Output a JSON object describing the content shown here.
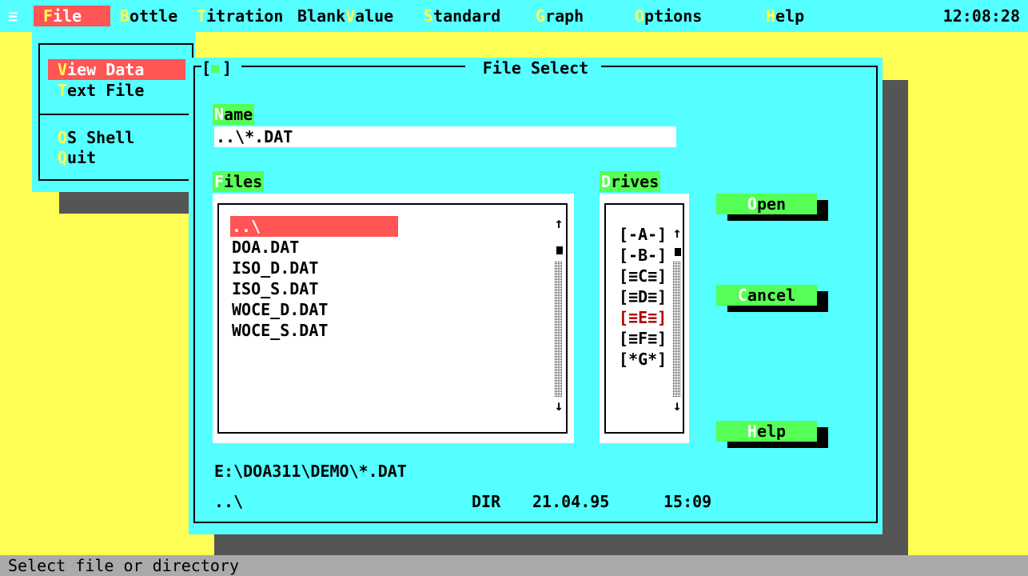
{
  "menubar": {
    "system_glyph": "≡",
    "items": [
      {
        "hotkey": "F",
        "rest": "ile"
      },
      {
        "hotkey": "B",
        "rest": "ottle"
      },
      {
        "hotkey": "T",
        "rest": "itration"
      },
      {
        "hotkey": "",
        "rest": "Blank"
      },
      {
        "hotkey": "V",
        "rest": "alue"
      },
      {
        "hotkey": "S",
        "rest": "tandard"
      },
      {
        "hotkey": "G",
        "rest": "raph"
      },
      {
        "hotkey": "O",
        "rest": "ptions"
      },
      {
        "hotkey": "H",
        "rest": "elp"
      }
    ],
    "clock": "12:08:28"
  },
  "file_menu": {
    "items": [
      {
        "hotkey": "V",
        "rest": "iew Data",
        "selected": true
      },
      {
        "hotkey": "T",
        "rest": "ext File",
        "selected": false
      },
      {
        "hotkey": "O",
        "rest": "S Shell",
        "selected": false
      },
      {
        "hotkey": "Q",
        "rest": "uit",
        "selected": false
      }
    ]
  },
  "dialog": {
    "title": "File Select",
    "close_left": "[",
    "close_right": "]",
    "name_label": {
      "hotkey": "N",
      "rest": "ame"
    },
    "name_value": "..\\*.DAT",
    "files_label": {
      "hotkey": "F",
      "rest": "iles"
    },
    "files": [
      "..\\",
      "DOA.DAT",
      "ISO_D.DAT",
      "ISO_S.DAT",
      "WOCE_D.DAT",
      "WOCE_S.DAT"
    ],
    "selected_file_index": 0,
    "drives_label": {
      "hotkey": "D",
      "rest": "rives"
    },
    "drives": [
      "[-A-]",
      "[-B-]",
      "[≡C≡]",
      "[≡D≡]",
      "[≡E≡]",
      "[≡F≡]",
      "[*G*]"
    ],
    "current_drive_index": 4,
    "buttons": {
      "open": {
        "hotkey": "O",
        "rest": "pen"
      },
      "cancel": {
        "hotkey": "C",
        "rest": "ancel"
      },
      "help": {
        "hotkey": "H",
        "rest": "elp"
      }
    },
    "path": "E:\\DOA311\\DEMO\\*.DAT",
    "info": {
      "name": "..\\",
      "type": "DIR",
      "date": "21.04.95",
      "time": "15:09"
    }
  },
  "scroll_arrows": {
    "up": "↑",
    "down": "↓"
  },
  "colors": {
    "desktop": "#ffff55",
    "cyan": "#55ffff",
    "green": "#55ff55",
    "selection": "#ff5555",
    "shadow": "#555555",
    "status_bar": "#aaaaaa",
    "current_drive": "#aa0000"
  },
  "status": "Select file or directory"
}
